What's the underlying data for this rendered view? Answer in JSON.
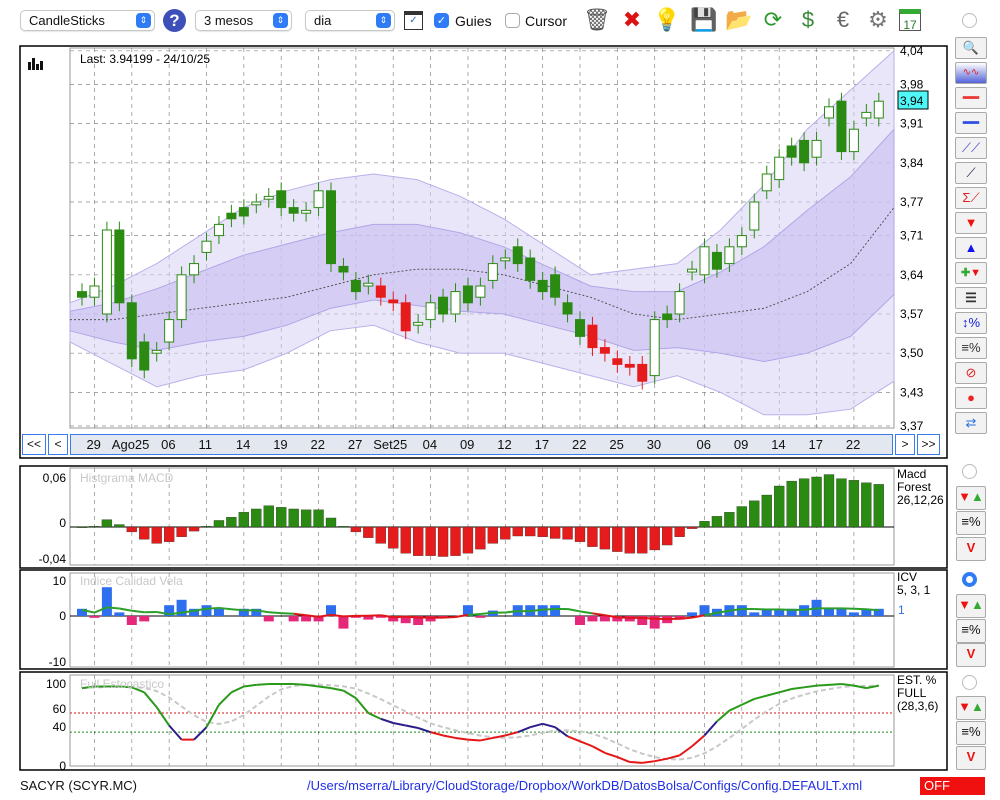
{
  "toolbar": {
    "chart_type": "CandleSticks",
    "period": "3 mesos",
    "interval": "dia",
    "guides_label": "Guies",
    "guides_checked": true,
    "cursor_label": "Cursor",
    "cursor_checked": false,
    "icons": [
      "trash-icon",
      "delete-icon",
      "lamp-icon",
      "save-icon",
      "folder-icon",
      "refresh-icon",
      "update-icon",
      "euro-icon",
      "gear-icon",
      "calendar-icon"
    ],
    "icon_glyphs": [
      "🗑",
      "✖",
      "💡",
      "💾",
      "📂",
      "⟳",
      "$",
      "€",
      "⚙",
      "17"
    ]
  },
  "main_chart": {
    "last_label": "Last: 3.94199 - 24/10/25",
    "current_price": "3,94",
    "price_ticks": [
      "4,04",
      "3,98",
      "3,91",
      "3,84",
      "3,77",
      "3,71",
      "3,64",
      "3,57",
      "3,50",
      "3,43",
      "3,37"
    ],
    "price_tick_values": [
      4.04,
      3.98,
      3.91,
      3.84,
      3.77,
      3.71,
      3.64,
      3.57,
      3.5,
      3.43,
      3.37
    ],
    "date_labels": [
      [
        "29",
        1
      ],
      [
        "Ago25",
        4
      ],
      [
        "06",
        7
      ],
      [
        "11",
        10
      ],
      [
        "14",
        13
      ],
      [
        "19",
        16
      ],
      [
        "22",
        19
      ],
      [
        "27",
        22
      ],
      [
        "Set25",
        25
      ],
      [
        "04",
        28
      ],
      [
        "09",
        31
      ],
      [
        "12",
        34
      ],
      [
        "17",
        37
      ],
      [
        "22",
        40
      ],
      [
        "25",
        43
      ],
      [
        "30",
        46
      ],
      [
        "06",
        50
      ],
      [
        "09",
        53
      ],
      [
        "14",
        56
      ],
      [
        "17",
        59
      ],
      [
        "22",
        62
      ]
    ],
    "nav": {
      "first": "<<",
      "prev": "<",
      "next": ">",
      "last": ">>"
    },
    "candles": [
      [
        3.6,
        3.61,
        "g"
      ],
      [
        3.6,
        3.62,
        "u"
      ],
      [
        3.57,
        3.72,
        "u"
      ],
      [
        3.72,
        3.59,
        "g"
      ],
      [
        3.59,
        3.49,
        "g"
      ],
      [
        3.52,
        3.47,
        "g"
      ],
      [
        3.5,
        3.505,
        "u"
      ],
      [
        3.52,
        3.56,
        "u"
      ],
      [
        3.56,
        3.64,
        "u"
      ],
      [
        3.64,
        3.66,
        "u"
      ],
      [
        3.68,
        3.7,
        "u"
      ],
      [
        3.71,
        3.73,
        "u"
      ],
      [
        3.75,
        3.74,
        "g"
      ],
      [
        3.76,
        3.745,
        "g"
      ],
      [
        3.765,
        3.77,
        "u"
      ],
      [
        3.775,
        3.78,
        "u"
      ],
      [
        3.79,
        3.76,
        "g"
      ],
      [
        3.76,
        3.75,
        "g"
      ],
      [
        3.75,
        3.755,
        "u"
      ],
      [
        3.76,
        3.79,
        "u"
      ],
      [
        3.79,
        3.66,
        "g"
      ],
      [
        3.655,
        3.645,
        "g"
      ],
      [
        3.63,
        3.61,
        "g"
      ],
      [
        3.62,
        3.625,
        "u"
      ],
      [
        3.62,
        3.6,
        "r"
      ],
      [
        3.595,
        3.59,
        "r"
      ],
      [
        3.59,
        3.54,
        "r"
      ],
      [
        3.55,
        3.555,
        "u"
      ],
      [
        3.56,
        3.59,
        "u"
      ],
      [
        3.6,
        3.57,
        "g"
      ],
      [
        3.57,
        3.61,
        "u"
      ],
      [
        3.62,
        3.59,
        "g"
      ],
      [
        3.6,
        3.62,
        "u"
      ],
      [
        3.63,
        3.66,
        "u"
      ],
      [
        3.665,
        3.67,
        "u"
      ],
      [
        3.69,
        3.66,
        "g"
      ],
      [
        3.67,
        3.63,
        "g"
      ],
      [
        3.63,
        3.61,
        "g"
      ],
      [
        3.64,
        3.6,
        "g"
      ],
      [
        3.59,
        3.57,
        "g"
      ],
      [
        3.56,
        3.53,
        "g"
      ],
      [
        3.55,
        3.51,
        "r"
      ],
      [
        3.51,
        3.5,
        "r"
      ],
      [
        3.49,
        3.48,
        "r"
      ],
      [
        3.48,
        3.475,
        "r"
      ],
      [
        3.48,
        3.45,
        "r"
      ],
      [
        3.46,
        3.56,
        "u"
      ],
      [
        3.57,
        3.56,
        "g"
      ],
      [
        3.57,
        3.61,
        "u"
      ],
      [
        3.645,
        3.65,
        "u"
      ],
      [
        3.64,
        3.69,
        "u"
      ],
      [
        3.68,
        3.65,
        "g"
      ],
      [
        3.66,
        3.69,
        "u"
      ],
      [
        3.69,
        3.71,
        "u"
      ],
      [
        3.72,
        3.77,
        "u"
      ],
      [
        3.79,
        3.82,
        "u"
      ],
      [
        3.81,
        3.85,
        "u"
      ],
      [
        3.87,
        3.85,
        "g"
      ],
      [
        3.88,
        3.84,
        "g"
      ],
      [
        3.85,
        3.88,
        "u"
      ],
      [
        3.92,
        3.94,
        "u"
      ],
      [
        3.95,
        3.86,
        "g"
      ],
      [
        3.86,
        3.9,
        "u"
      ],
      [
        3.92,
        3.93,
        "u"
      ],
      [
        3.92,
        3.95,
        "u"
      ]
    ],
    "bollinger": {
      "upper": [
        3.59,
        3.62,
        3.66,
        3.71,
        3.76,
        3.79,
        3.81,
        3.82,
        3.81,
        3.78,
        3.74,
        3.69,
        3.64,
        3.65,
        3.66,
        3.72,
        3.8,
        3.9,
        3.97,
        4.04
      ],
      "middle": [
        3.56,
        3.56,
        3.57,
        3.58,
        3.59,
        3.6,
        3.62,
        3.64,
        3.65,
        3.65,
        3.64,
        3.62,
        3.6,
        3.57,
        3.56,
        3.57,
        3.58,
        3.61,
        3.66,
        3.76
      ],
      "lower": [
        3.52,
        3.48,
        3.44,
        3.46,
        3.47,
        3.5,
        3.54,
        3.55,
        3.52,
        3.5,
        3.5,
        3.48,
        3.46,
        3.44,
        3.46,
        3.43,
        3.39,
        3.39,
        3.4,
        3.45
      ]
    }
  },
  "macd": {
    "title": "Histgrama MACD",
    "legend": [
      "Macd",
      "Forest",
      "26,12,26"
    ],
    "ticks": [
      "0,06",
      "0",
      "-0,04"
    ],
    "values": [
      0,
      0.001,
      0.009,
      0.003,
      -0.006,
      -0.015,
      -0.02,
      -0.018,
      -0.012,
      -0.005,
      0.001,
      0.008,
      0.012,
      0.018,
      0.022,
      0.026,
      0.024,
      0.022,
      0.021,
      0.021,
      0.011,
      0.001,
      -0.006,
      -0.013,
      -0.02,
      -0.026,
      -0.032,
      -0.035,
      -0.035,
      -0.036,
      -0.035,
      -0.032,
      -0.027,
      -0.02,
      -0.015,
      -0.011,
      -0.011,
      -0.012,
      -0.014,
      -0.015,
      -0.018,
      -0.024,
      -0.027,
      -0.03,
      -0.032,
      -0.032,
      -0.028,
      -0.022,
      -0.012,
      -0.002,
      0.007,
      0.013,
      0.018,
      0.025,
      0.032,
      0.039,
      0.05,
      0.056,
      0.059,
      0.061,
      0.064,
      0.059,
      0.057,
      0.054,
      0.052
    ]
  },
  "icv": {
    "title": "Indice Calidad Vela",
    "legend": [
      "ICV",
      "5, 3, 1"
    ],
    "value": "1",
    "ticks": [
      "10",
      "0",
      "-10"
    ],
    "values": [
      2,
      -0.5,
      8,
      1,
      -2.5,
      -1.5,
      0,
      3,
      4.5,
      2,
      3,
      2,
      0,
      2,
      2,
      -1.5,
      0,
      -1.5,
      -1.5,
      -1.5,
      3,
      -3.5,
      -0.5,
      -1,
      -0.5,
      -1.5,
      -2,
      -2.5,
      -1.5,
      -0.5,
      0,
      3,
      -0.5,
      1.5,
      0,
      3,
      3,
      3,
      3,
      0,
      -2.5,
      -1.5,
      -1.5,
      -1.5,
      -1.5,
      -2.5,
      -3.5,
      -2,
      -1,
      1,
      3,
      2,
      3,
      3,
      1,
      2,
      2,
      2,
      3,
      4.5,
      2,
      2,
      1,
      2,
      2
    ]
  },
  "stoch": {
    "title": "Full Estocastico",
    "legend": [
      "EST. %",
      "FULL",
      "(28,3,6)"
    ],
    "ticks": [
      "100",
      "60",
      "40",
      "0"
    ],
    "values": [
      95,
      97,
      97,
      97,
      96,
      90,
      72,
      50,
      33,
      33,
      48,
      75,
      90,
      97,
      99,
      100,
      100,
      100,
      99,
      97,
      95,
      92,
      83,
      65,
      58,
      53,
      50,
      47,
      42,
      38,
      35,
      33,
      32,
      35,
      38,
      42,
      48,
      52,
      48,
      37,
      31,
      25,
      17,
      12,
      6,
      5,
      7,
      10,
      14,
      25,
      38,
      55,
      68,
      75,
      82,
      86,
      90,
      94,
      96,
      98,
      99,
      100,
      98,
      95,
      98
    ]
  },
  "status": {
    "symbol": "SACYR (SCYR.MC)",
    "path": "/Users/mserra/Library/CloudStorage/Dropbox/WorkDB/DatosBolsa/Configs/Config.DEFAULT.xml",
    "mode": "OFF"
  },
  "colors": {
    "up": "#ffffff",
    "green": "#2a8a12",
    "red": "#e61b1b",
    "blue": "#2e6ff0",
    "pink": "#e6287a",
    "band": "#d9d2f5"
  }
}
